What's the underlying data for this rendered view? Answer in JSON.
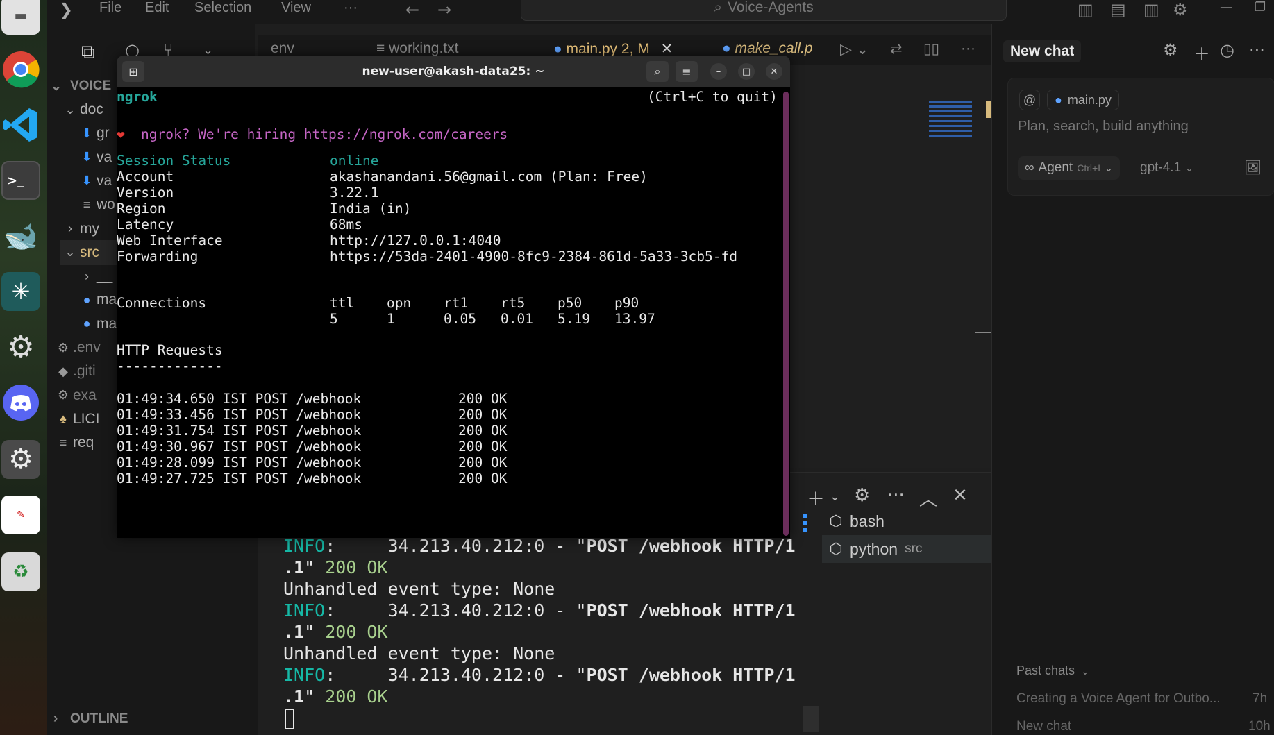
{
  "dock": {
    "apps": [
      "Files",
      "Chrome",
      "VS Code",
      "Terminal",
      "DeepSeek",
      "Perplexity",
      "Settings",
      "Discord",
      "System Settings",
      "Image",
      "Trash"
    ],
    "terminal_glyph": ">_"
  },
  "vscode": {
    "menu": [
      "File",
      "Edit",
      "Selection",
      "View",
      "···"
    ],
    "search": "Voice-Agents",
    "sidebar": {
      "root": "VOICE",
      "items": [
        {
          "label": "doc",
          "icon": "chevron-down-icon"
        },
        {
          "label": "gr",
          "icon": "download-icon"
        },
        {
          "label": "va",
          "icon": "download-icon"
        },
        {
          "label": "va",
          "icon": "download-icon"
        },
        {
          "label": "wo",
          "icon": "lines-icon"
        },
        {
          "label": "my",
          "icon": "chevron-right-icon"
        },
        {
          "label": "src",
          "icon": "chevron-down-icon"
        },
        {
          "label": "__",
          "icon": "chevron-right-icon"
        },
        {
          "label": "ma",
          "icon": "python-icon"
        },
        {
          "label": "ma",
          "icon": "python-icon"
        },
        {
          "label": ".env",
          "icon": "gear-icon"
        },
        {
          "label": ".giti",
          "icon": "git-icon"
        },
        {
          "label": "exa",
          "icon": "gear-icon"
        },
        {
          "label": "LICI",
          "icon": "license-icon"
        },
        {
          "label": "req",
          "icon": "lines-icon"
        }
      ],
      "outline": "OUTLINE"
    },
    "tabs": [
      {
        "label": "env"
      },
      {
        "label": "working.txt"
      },
      {
        "label": "main.py 2, M"
      },
      {
        "label": "make_call.p"
      }
    ],
    "terminal_output": [
      {
        "parts": [
          {
            "t": "INFO",
            "c": "info"
          },
          {
            "t": ":     34.213.40.212:0 - \"",
            "c": ""
          },
          {
            "t": "POST /webhook HTTP/1",
            "c": "bold"
          }
        ]
      },
      {
        "parts": [
          {
            "t": ".1",
            "c": "bold"
          },
          {
            "t": "\" ",
            "c": ""
          },
          {
            "t": "200 OK",
            "c": "ok"
          }
        ]
      },
      {
        "parts": [
          {
            "t": "Unhandled event type: None",
            "c": ""
          }
        ]
      },
      {
        "parts": [
          {
            "t": "INFO",
            "c": "info"
          },
          {
            "t": ":     34.213.40.212:0 - \"",
            "c": ""
          },
          {
            "t": "POST /webhook HTTP/1",
            "c": "bold"
          }
        ]
      },
      {
        "parts": [
          {
            "t": ".1",
            "c": "bold"
          },
          {
            "t": "\" ",
            "c": ""
          },
          {
            "t": "200 OK",
            "c": "ok"
          }
        ]
      },
      {
        "parts": [
          {
            "t": "Unhandled event type: None",
            "c": ""
          }
        ]
      },
      {
        "parts": [
          {
            "t": "INFO",
            "c": "info"
          },
          {
            "t": ":     34.213.40.212:0 - \"",
            "c": ""
          },
          {
            "t": "POST /webhook HTTP/1",
            "c": "bold"
          }
        ]
      },
      {
        "parts": [
          {
            "t": ".1",
            "c": "bold"
          },
          {
            "t": "\" ",
            "c": ""
          },
          {
            "t": "200 OK",
            "c": "ok"
          }
        ]
      }
    ],
    "terminals": [
      {
        "label": "bash",
        "sub": ""
      },
      {
        "label": "python",
        "sub": "src"
      }
    ]
  },
  "chat": {
    "title": "New chat",
    "context_chip": "main.py",
    "at": "@",
    "placeholder": "Plan, search, build anything",
    "mode": "Agent",
    "mode_shortcut": "Ctrl+I",
    "model": "gpt-4.1",
    "past_label": "Past chats",
    "past": [
      {
        "title": "Creating a Voice Agent for Outbo...",
        "time": "7h"
      },
      {
        "title": "New chat",
        "time": "10h"
      }
    ]
  },
  "ngrok": {
    "window_title": "new-user@akash-data25: ~",
    "app": "ngrok",
    "quit_hint": "(Ctrl+C to quit)",
    "hiring": "ngrok? We're hiring https://ngrok.com/careers",
    "fields": [
      {
        "k": "Session Status",
        "v": "online"
      },
      {
        "k": "Account",
        "v": "akashanandani.56@gmail.com (Plan: Free)"
      },
      {
        "k": "Version",
        "v": "3.22.1"
      },
      {
        "k": "Region",
        "v": "India (in)"
      },
      {
        "k": "Latency",
        "v": "68ms"
      },
      {
        "k": "Web Interface",
        "v": "http://127.0.0.1:4040"
      },
      {
        "k": "Forwarding",
        "v": "https://53da-2401-4900-8fc9-2384-861d-5a33-3cb5-fd"
      }
    ],
    "connections_label": "Connections",
    "conn_headers": [
      "ttl",
      "opn",
      "rt1",
      "rt5",
      "p50",
      "p90"
    ],
    "conn_values": [
      "5",
      "1",
      "0.05",
      "0.01",
      "5.19",
      "13.97"
    ],
    "http_label": "HTTP Requests",
    "http_rule": "-------------",
    "requests": [
      {
        "time": "01:49:34.650 IST",
        "method": "POST",
        "path": "/webhook",
        "status": "200 OK"
      },
      {
        "time": "01:49:33.456 IST",
        "method": "POST",
        "path": "/webhook",
        "status": "200 OK"
      },
      {
        "time": "01:49:31.754 IST",
        "method": "POST",
        "path": "/webhook",
        "status": "200 OK"
      },
      {
        "time": "01:49:30.967 IST",
        "method": "POST",
        "path": "/webhook",
        "status": "200 OK"
      },
      {
        "time": "01:49:28.099 IST",
        "method": "POST",
        "path": "/webhook",
        "status": "200 OK"
      },
      {
        "time": "01:49:27.725 IST",
        "method": "POST",
        "path": "/webhook",
        "status": "200 OK"
      }
    ]
  },
  "colors": {
    "accent": "#26a69a",
    "magenta": "#c566c5",
    "scrollbar": "#6b2d5b"
  }
}
